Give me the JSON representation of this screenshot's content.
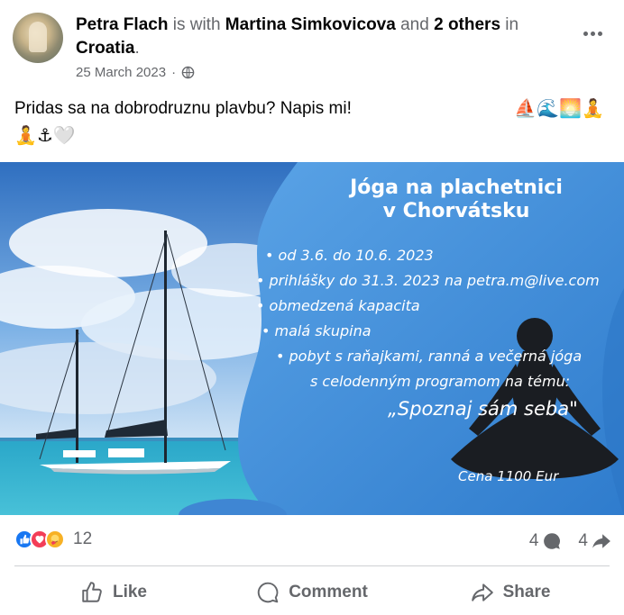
{
  "post": {
    "author": "Petra Flach",
    "with_text": " is with ",
    "tagged": "Martina Simkovicova",
    "and_text": " and ",
    "others": "2 others",
    "in_text": " in ",
    "place": "Croatia",
    "period": ".",
    "date": "25 March 2023",
    "separator": "·",
    "privacy_icon": "globe-icon",
    "text": "Pridas sa na dobrodruznu plavbu? Napis mi!",
    "emojis_line1": "⛵🌊🌅🧘",
    "emojis_line2": "🧘⚓🤍"
  },
  "image": {
    "headline1": "Jóga na plachetnici",
    "headline2": "v Chorvátsku",
    "bullets": [
      "• od 3.6. do 10.6. 2023",
      "• prihlášky do 31.3. 2023 na petra.m@live.com",
      "• obmedzená kapacita",
      "• malá skupina",
      "• pobyt s raňajkami, ranná a večerná jóga",
      "s celodenným programom na tému:"
    ],
    "quote": "„Spoznaj sám seba\"",
    "price": "Cena 1100 Eur",
    "colors": {
      "sky": "#4d8fd6",
      "sea": "#1f9fbf",
      "panel": "#3b84d1"
    }
  },
  "engagement": {
    "reactions_count": "12",
    "comments_count": "4",
    "shares_count": "4",
    "reaction_icons": [
      "like-icon",
      "love-icon",
      "care-icon"
    ]
  },
  "actions": {
    "like": "Like",
    "comment": "Comment",
    "share": "Share"
  },
  "colors": {
    "facebook_blue": "#1877f2",
    "secondary_text": "#65676b",
    "divider": "#ced0d4"
  }
}
